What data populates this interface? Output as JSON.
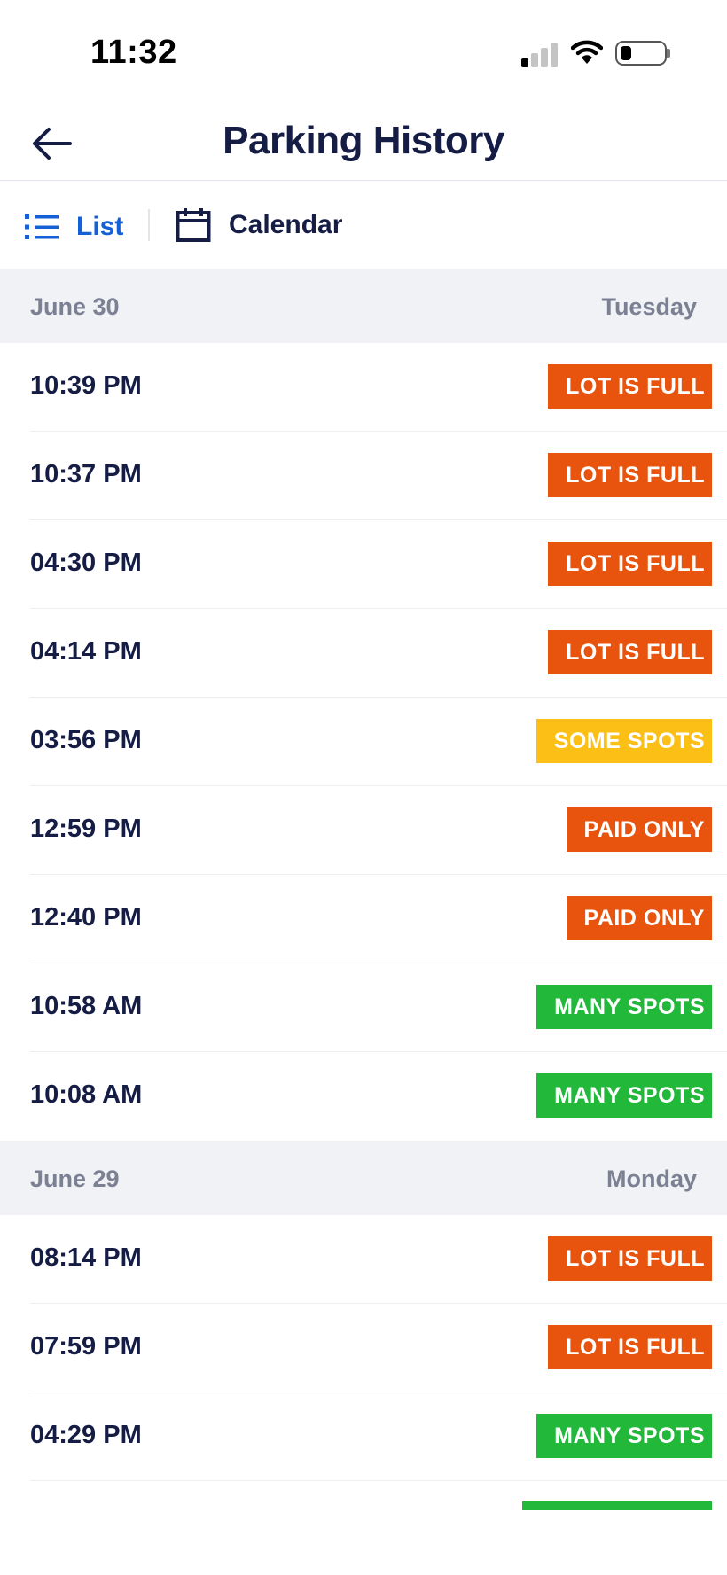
{
  "status_bar": {
    "time": "11:32"
  },
  "nav": {
    "title": "Parking History"
  },
  "view_toggle": {
    "list_label": "List",
    "calendar_label": "Calendar",
    "selected": "List"
  },
  "colors": {
    "accent": "#1560d6",
    "lot_full": "#e8530e",
    "paid_only": "#e8530e",
    "some_spots": "#fcbf15",
    "many_spots": "#22b93b"
  },
  "sections": [
    {
      "date": "June 30",
      "day": "Tuesday",
      "entries": [
        {
          "time": "10:39 PM",
          "status": "LOT IS FULL"
        },
        {
          "time": "10:37 PM",
          "status": "LOT IS FULL"
        },
        {
          "time": "04:30 PM",
          "status": "LOT IS FULL"
        },
        {
          "time": "04:14 PM",
          "status": "LOT IS FULL"
        },
        {
          "time": "03:56 PM",
          "status": "SOME SPOTS"
        },
        {
          "time": "12:59 PM",
          "status": "PAID ONLY"
        },
        {
          "time": "12:40 PM",
          "status": "PAID ONLY"
        },
        {
          "time": "10:58 AM",
          "status": "MANY SPOTS"
        },
        {
          "time": "10:08 AM",
          "status": "MANY SPOTS"
        }
      ]
    },
    {
      "date": "June 29",
      "day": "Monday",
      "entries": [
        {
          "time": "08:14 PM",
          "status": "LOT IS FULL"
        },
        {
          "time": "07:59 PM",
          "status": "LOT IS FULL"
        },
        {
          "time": "04:29 PM",
          "status": "MANY SPOTS"
        }
      ]
    }
  ]
}
